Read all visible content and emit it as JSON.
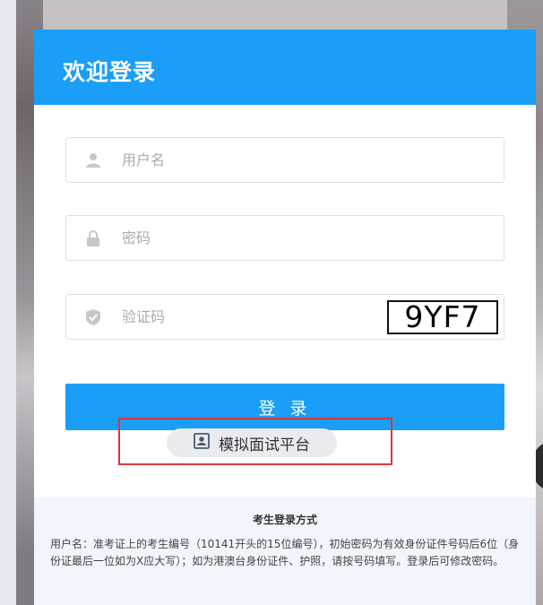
{
  "login": {
    "title": "欢迎登录",
    "username_placeholder": "用户名",
    "password_placeholder": "密码",
    "captcha_placeholder": "验证码",
    "captcha_image_text": "9YF7",
    "submit_label": "登 录",
    "mock_interview_label": "模拟面试平台"
  },
  "footer": {
    "title": "考生登录方式",
    "text": "用户名：准考证上的考生编号（10141开头的15位编号），初始密码为有效身份证件号码后6位（身份证最后一位如为X应大写）；如为港澳台身份证件、护照，请按号码填写。登录后可修改密码。"
  },
  "colors": {
    "accent": "#1a9ef7",
    "highlight_border": "#d9363e",
    "footer_bg": "#f2f5fb"
  },
  "icons": {
    "username": "user-icon",
    "password": "lock-icon",
    "captcha": "shield-check-icon",
    "mock_interview": "id-card-icon"
  }
}
